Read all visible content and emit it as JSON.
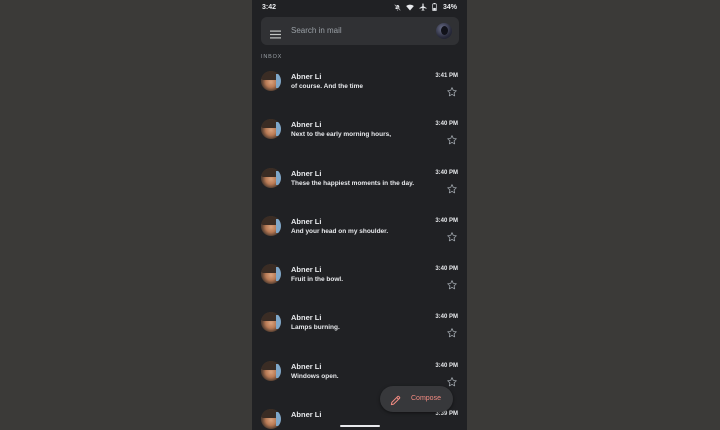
{
  "status_bar": {
    "time": "3:42",
    "battery": "34%",
    "icons": [
      "do-not-disturb-off-icon",
      "wifi-icon",
      "airplane-icon",
      "battery-icon"
    ]
  },
  "search": {
    "placeholder": "Search in mail",
    "menu_icon": "hamburger-menu-icon",
    "account_icon": "account-avatar"
  },
  "section_label": "INBOX",
  "emails": [
    {
      "sender": "Abner Li",
      "subject": "of course. And the time",
      "time": "3:41 PM",
      "starred": false
    },
    {
      "sender": "Abner Li",
      "subject": "Next to the early morning hours,",
      "time": "3:40 PM",
      "starred": false
    },
    {
      "sender": "Abner Li",
      "subject": "These the happiest moments in the day.",
      "time": "3:40 PM",
      "starred": false
    },
    {
      "sender": "Abner Li",
      "subject": "And your head on my shoulder.",
      "time": "3:40 PM",
      "starred": false
    },
    {
      "sender": "Abner Li",
      "subject": "Fruit in the bowl.",
      "time": "3:40 PM",
      "starred": false
    },
    {
      "sender": "Abner Li",
      "subject": "Lamps burning.",
      "time": "3:40 PM",
      "starred": false
    },
    {
      "sender": "Abner Li",
      "subject": "Windows open.",
      "time": "3:40 PM",
      "starred": false
    },
    {
      "sender": "Abner Li",
      "subject": "",
      "time": "3:39 PM",
      "starred": false
    }
  ],
  "compose": {
    "label": "Compose",
    "icon": "pencil-icon"
  },
  "colors": {
    "background": "#202124",
    "surface": "#303134",
    "text_primary": "#e8eaed",
    "text_secondary": "#9aa0a6",
    "compose_accent": "#f28b82"
  }
}
